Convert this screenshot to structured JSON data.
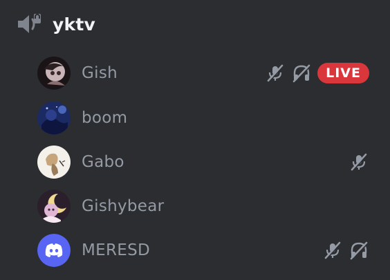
{
  "channel": {
    "name": "yktv",
    "icon": "voice-channel-speaker-icon"
  },
  "members": [
    {
      "name": "Gish",
      "avatar": "anime-avatar-dark",
      "muted": true,
      "deafened": true,
      "live_label": "LIVE"
    },
    {
      "name": "boom",
      "avatar": "night-scene-avatar",
      "muted": false,
      "deafened": false
    },
    {
      "name": "Gabo",
      "avatar": "sketch-avatar-light",
      "muted": true,
      "deafened": false
    },
    {
      "name": "Gishybear",
      "avatar": "moon-avatar-pink",
      "muted": false,
      "deafened": false
    },
    {
      "name": "MERESD",
      "avatar": "discord-default-avatar",
      "muted": true,
      "deafened": true
    }
  ],
  "colors": {
    "background": "#2b2d31",
    "member_text": "#949ba4",
    "channel_text": "#f2f3f5",
    "live_badge": "#da373c",
    "discord_blurple": "#5865f2"
  }
}
